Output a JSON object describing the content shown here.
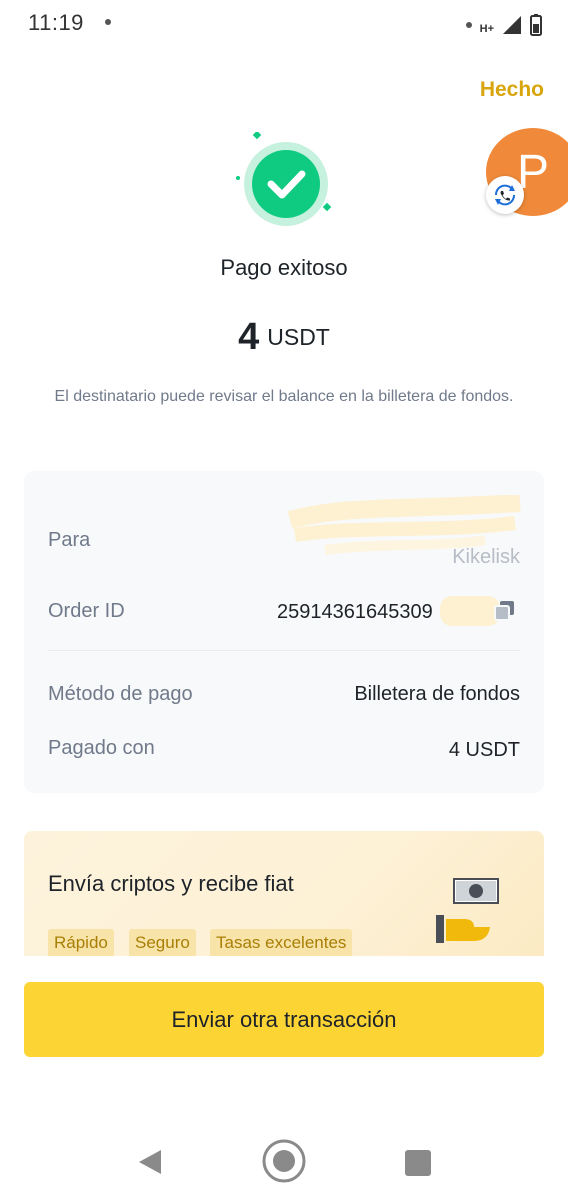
{
  "status_bar": {
    "time": "11:19",
    "network": "H+"
  },
  "header": {
    "done_label": "Hecho"
  },
  "result": {
    "title": "Pago exitoso",
    "amount": "4",
    "currency": "USDT",
    "description": "El destinatario puede revisar el balance en la billetera de fondos."
  },
  "details": {
    "to_label": "Para",
    "to_value": "Kikelisk",
    "order_id_label": "Order ID",
    "order_id_value": "25914361645309",
    "method_label": "Método de pago",
    "method_value": "Billetera de fondos",
    "paid_with_label": "Pagado con",
    "paid_with_value": "4 USDT"
  },
  "avatar": {
    "letter": "P"
  },
  "promo": {
    "title": "Envía criptos y recibe fiat",
    "tags": [
      "Rápido",
      "Seguro",
      "Tasas excelentes"
    ]
  },
  "cta": {
    "label": "Enviar otra transacción"
  },
  "colors": {
    "accent_yellow": "#fcd535",
    "done_text": "#d8a50e",
    "success_green": "#0ecb81",
    "avatar_orange": "#f08a3a"
  },
  "icons": [
    "success-check-icon",
    "copy-icon",
    "phone-sync-icon",
    "battery-icon",
    "signal-icon",
    "cash-hand-icon",
    "back-nav-icon",
    "home-nav-icon",
    "recent-apps-icon"
  ]
}
